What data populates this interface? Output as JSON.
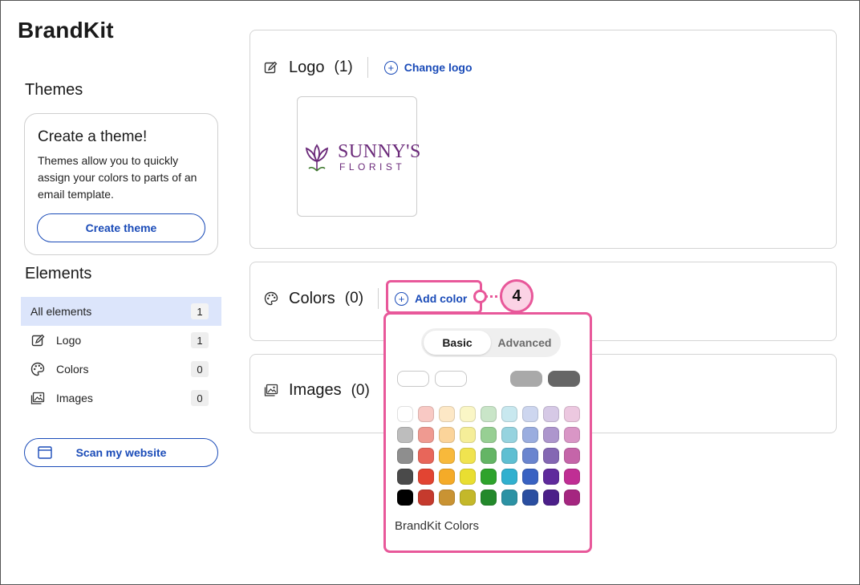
{
  "app": {
    "title": "BrandKit"
  },
  "themes": {
    "heading": "Themes",
    "card_title": "Create a theme!",
    "card_text": "Themes allow you to quickly assign your colors to parts of an email template.",
    "create_button": "Create theme"
  },
  "elements": {
    "heading": "Elements",
    "items": [
      {
        "label": "All elements",
        "count": "1",
        "icon": "",
        "active": true
      },
      {
        "label": "Logo",
        "count": "1",
        "icon": "logo-edit-icon",
        "active": false
      },
      {
        "label": "Colors",
        "count": "0",
        "icon": "palette-icon",
        "active": false
      },
      {
        "label": "Images",
        "count": "0",
        "icon": "images-icon",
        "active": false
      }
    ],
    "scan_button": "Scan my website"
  },
  "logo_panel": {
    "title": "Logo",
    "count": "(1)",
    "action": "Change logo",
    "logo_name": "SUNNY'S",
    "logo_sub": "FLORIST"
  },
  "colors_panel": {
    "title": "Colors",
    "count": "(0)",
    "action": "Add color"
  },
  "images_panel": {
    "title": "Images",
    "count": "(0)"
  },
  "callout": {
    "number": "4"
  },
  "picker": {
    "tabs": [
      "Basic",
      "Advanced"
    ],
    "active_tab": "Basic",
    "big_swatches": [
      "#ffffff",
      "#ffffff",
      "#ffffff",
      "#a9a9a9",
      "#666666"
    ],
    "grid": [
      [
        "#ffffff",
        "#f8c9c4",
        "#fde8c6",
        "#faf6c6",
        "#c9e5c8",
        "#c8e8ef",
        "#cdd6ef",
        "#d6c9e6",
        "#ecc8e0"
      ],
      [
        "#bdbdbd",
        "#ef9a91",
        "#fbd49a",
        "#f5ee99",
        "#97cf93",
        "#96d3df",
        "#9aaddf",
        "#ad96cd",
        "#d996c6"
      ],
      [
        "#8e8e8e",
        "#e8665a",
        "#f8b93b",
        "#f0e34f",
        "#64b565",
        "#5fbfd2",
        "#6a85cf",
        "#8467b3",
        "#c565a9"
      ],
      [
        "#4a4a4a",
        "#e24432",
        "#f5ab28",
        "#e9de31",
        "#2ea32c",
        "#31b0cf",
        "#3962c2",
        "#5f2a9c",
        "#c02e94"
      ],
      [
        "#000000",
        "#c53a2d",
        "#c99333",
        "#c4b82a",
        "#23892b",
        "#2c92a4",
        "#2a4ea0",
        "#4b1f89",
        "#a52680"
      ]
    ],
    "label": "BrandKit Colors"
  },
  "accent": {
    "link_blue": "#1a4bb8",
    "highlight_pink": "#e8589a",
    "active_row": "#dce5fb"
  }
}
